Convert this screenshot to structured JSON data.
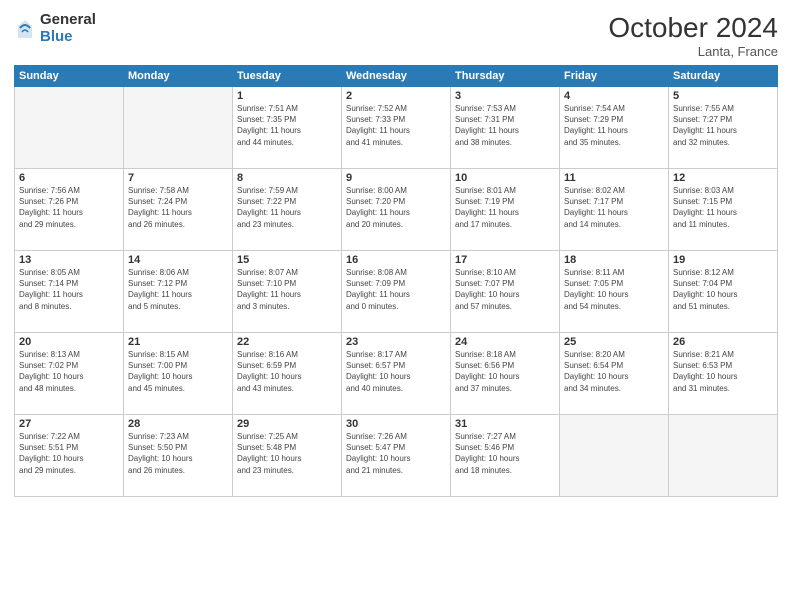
{
  "logo": {
    "general": "General",
    "blue": "Blue"
  },
  "title": "October 2024",
  "location": "Lanta, France",
  "days_header": [
    "Sunday",
    "Monday",
    "Tuesday",
    "Wednesday",
    "Thursday",
    "Friday",
    "Saturday"
  ],
  "weeks": [
    [
      {
        "num": "",
        "info": ""
      },
      {
        "num": "",
        "info": ""
      },
      {
        "num": "1",
        "info": "Sunrise: 7:51 AM\nSunset: 7:35 PM\nDaylight: 11 hours\nand 44 minutes."
      },
      {
        "num": "2",
        "info": "Sunrise: 7:52 AM\nSunset: 7:33 PM\nDaylight: 11 hours\nand 41 minutes."
      },
      {
        "num": "3",
        "info": "Sunrise: 7:53 AM\nSunset: 7:31 PM\nDaylight: 11 hours\nand 38 minutes."
      },
      {
        "num": "4",
        "info": "Sunrise: 7:54 AM\nSunset: 7:29 PM\nDaylight: 11 hours\nand 35 minutes."
      },
      {
        "num": "5",
        "info": "Sunrise: 7:55 AM\nSunset: 7:27 PM\nDaylight: 11 hours\nand 32 minutes."
      }
    ],
    [
      {
        "num": "6",
        "info": "Sunrise: 7:56 AM\nSunset: 7:26 PM\nDaylight: 11 hours\nand 29 minutes."
      },
      {
        "num": "7",
        "info": "Sunrise: 7:58 AM\nSunset: 7:24 PM\nDaylight: 11 hours\nand 26 minutes."
      },
      {
        "num": "8",
        "info": "Sunrise: 7:59 AM\nSunset: 7:22 PM\nDaylight: 11 hours\nand 23 minutes."
      },
      {
        "num": "9",
        "info": "Sunrise: 8:00 AM\nSunset: 7:20 PM\nDaylight: 11 hours\nand 20 minutes."
      },
      {
        "num": "10",
        "info": "Sunrise: 8:01 AM\nSunset: 7:19 PM\nDaylight: 11 hours\nand 17 minutes."
      },
      {
        "num": "11",
        "info": "Sunrise: 8:02 AM\nSunset: 7:17 PM\nDaylight: 11 hours\nand 14 minutes."
      },
      {
        "num": "12",
        "info": "Sunrise: 8:03 AM\nSunset: 7:15 PM\nDaylight: 11 hours\nand 11 minutes."
      }
    ],
    [
      {
        "num": "13",
        "info": "Sunrise: 8:05 AM\nSunset: 7:14 PM\nDaylight: 11 hours\nand 8 minutes."
      },
      {
        "num": "14",
        "info": "Sunrise: 8:06 AM\nSunset: 7:12 PM\nDaylight: 11 hours\nand 5 minutes."
      },
      {
        "num": "15",
        "info": "Sunrise: 8:07 AM\nSunset: 7:10 PM\nDaylight: 11 hours\nand 3 minutes."
      },
      {
        "num": "16",
        "info": "Sunrise: 8:08 AM\nSunset: 7:09 PM\nDaylight: 11 hours\nand 0 minutes."
      },
      {
        "num": "17",
        "info": "Sunrise: 8:10 AM\nSunset: 7:07 PM\nDaylight: 10 hours\nand 57 minutes."
      },
      {
        "num": "18",
        "info": "Sunrise: 8:11 AM\nSunset: 7:05 PM\nDaylight: 10 hours\nand 54 minutes."
      },
      {
        "num": "19",
        "info": "Sunrise: 8:12 AM\nSunset: 7:04 PM\nDaylight: 10 hours\nand 51 minutes."
      }
    ],
    [
      {
        "num": "20",
        "info": "Sunrise: 8:13 AM\nSunset: 7:02 PM\nDaylight: 10 hours\nand 48 minutes."
      },
      {
        "num": "21",
        "info": "Sunrise: 8:15 AM\nSunset: 7:00 PM\nDaylight: 10 hours\nand 45 minutes."
      },
      {
        "num": "22",
        "info": "Sunrise: 8:16 AM\nSunset: 6:59 PM\nDaylight: 10 hours\nand 43 minutes."
      },
      {
        "num": "23",
        "info": "Sunrise: 8:17 AM\nSunset: 6:57 PM\nDaylight: 10 hours\nand 40 minutes."
      },
      {
        "num": "24",
        "info": "Sunrise: 8:18 AM\nSunset: 6:56 PM\nDaylight: 10 hours\nand 37 minutes."
      },
      {
        "num": "25",
        "info": "Sunrise: 8:20 AM\nSunset: 6:54 PM\nDaylight: 10 hours\nand 34 minutes."
      },
      {
        "num": "26",
        "info": "Sunrise: 8:21 AM\nSunset: 6:53 PM\nDaylight: 10 hours\nand 31 minutes."
      }
    ],
    [
      {
        "num": "27",
        "info": "Sunrise: 7:22 AM\nSunset: 5:51 PM\nDaylight: 10 hours\nand 29 minutes."
      },
      {
        "num": "28",
        "info": "Sunrise: 7:23 AM\nSunset: 5:50 PM\nDaylight: 10 hours\nand 26 minutes."
      },
      {
        "num": "29",
        "info": "Sunrise: 7:25 AM\nSunset: 5:48 PM\nDaylight: 10 hours\nand 23 minutes."
      },
      {
        "num": "30",
        "info": "Sunrise: 7:26 AM\nSunset: 5:47 PM\nDaylight: 10 hours\nand 21 minutes."
      },
      {
        "num": "31",
        "info": "Sunrise: 7:27 AM\nSunset: 5:46 PM\nDaylight: 10 hours\nand 18 minutes."
      },
      {
        "num": "",
        "info": ""
      },
      {
        "num": "",
        "info": ""
      }
    ]
  ]
}
